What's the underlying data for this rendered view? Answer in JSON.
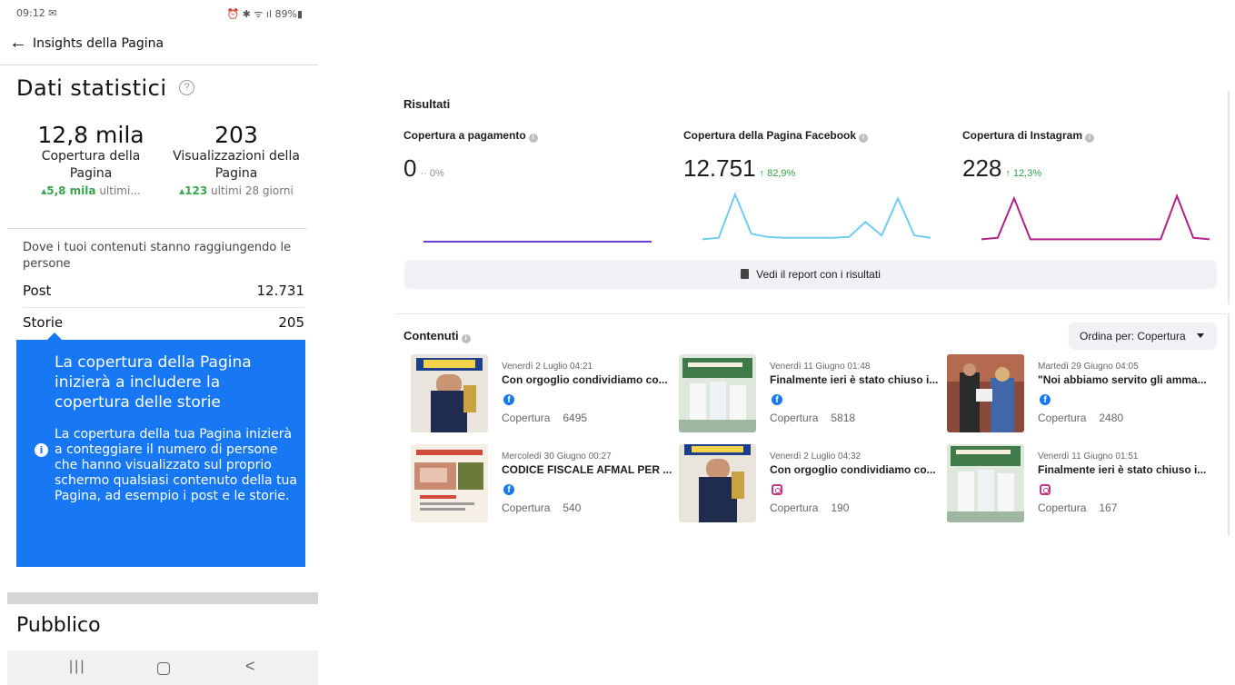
{
  "phone": {
    "status_time": "09:12 ✉",
    "status_icons": "⏰ ✱ ᯤ ıl 89%▮",
    "page_title": "Insights della Pagina",
    "stats_heading": "Dati statistici",
    "metrics": [
      {
        "value": "12,8 mila",
        "label": "Copertura della Pagina",
        "delta_value": "▴5,8 mila",
        "delta_text": " ultimi..."
      },
      {
        "value": "203",
        "label": "Visualizzazioni della Pagina",
        "delta_value": "▴123",
        "delta_text": " ultimi 28 giorni"
      }
    ],
    "where_text": "Dove i tuoi contenuti stanno raggiungendo le persone",
    "rows": [
      {
        "label": "Post",
        "value": "12.731"
      },
      {
        "label": "Storie",
        "value": "205"
      }
    ],
    "tooltip": {
      "title": "La copertura della Pagina inizierà a includere la copertura delle storie",
      "body": "La copertura della tua Pagina inizierà a conteggiare il numero di persone che hanno visualizzato sul proprio schermo qualsiasi contenuto della tua Pagina, ad esempio i post e le storie."
    },
    "audience_heading": "Pubblico",
    "nav": {
      "recents": "|||",
      "back": "<"
    }
  },
  "results": {
    "title": "Risultati",
    "kpis": [
      {
        "label": "Copertura a pagamento",
        "value": "0",
        "change": "·· 0%",
        "line_color": "#6b3fd4",
        "trend": [
          0,
          0,
          0,
          0,
          0,
          0,
          0,
          0,
          0,
          0,
          0,
          0,
          0,
          0
        ]
      },
      {
        "label": "Copertura della Pagina Facebook",
        "value": "12.751",
        "change": "↑ 82,9%",
        "line_color": "#6fcdf2",
        "trend": [
          3,
          5,
          60,
          10,
          6,
          5,
          5,
          5,
          5,
          6,
          25,
          8,
          55,
          8,
          5
        ]
      },
      {
        "label": "Copertura di Instagram",
        "value": "228",
        "change": "↑ 12,3%",
        "line_color": "#b21f8a",
        "trend": [
          3,
          5,
          55,
          3,
          3,
          3,
          3,
          3,
          3,
          3,
          3,
          3,
          58,
          5,
          3
        ]
      }
    ],
    "report_button": "Vedi il report con i risultati"
  },
  "content": {
    "title": "Contenuti",
    "sort_label": "Ordina per: Copertura",
    "posts": [
      {
        "date": "Venerdì 2 Luglio 04:21",
        "text": "Con orgoglio condividiamo co...",
        "network": "facebook",
        "metric_label": "Copertura",
        "metric_value": "6495"
      },
      {
        "date": "Venerdì 11 Giugno 01:48",
        "text": "Finalmente ieri è stato chiuso i...",
        "network": "facebook",
        "metric_label": "Copertura",
        "metric_value": "5818"
      },
      {
        "date": "Martedì 29 Giugno 04:05",
        "text": "\"Noi abbiamo servito gli amma...",
        "network": "facebook",
        "metric_label": "Copertura",
        "metric_value": "2480"
      },
      {
        "date": "Mercoledì 30 Giugno 00:27",
        "text": "CODICE FISCALE AFMAL PER ...",
        "network": "facebook",
        "metric_label": "Copertura",
        "metric_value": "540"
      },
      {
        "date": "Venerdì 2 Luglio 04:32",
        "text": "Con orgoglio condividiamo co...",
        "network": "instagram",
        "metric_label": "Copertura",
        "metric_value": "190"
      },
      {
        "date": "Venerdì 11 Giugno 01:51",
        "text": "Finalmente ieri è stato chiuso i...",
        "network": "instagram",
        "metric_label": "Copertura",
        "metric_value": "167"
      }
    ]
  },
  "colors": {
    "accent": "#1877f2",
    "positive": "#31a24c"
  }
}
